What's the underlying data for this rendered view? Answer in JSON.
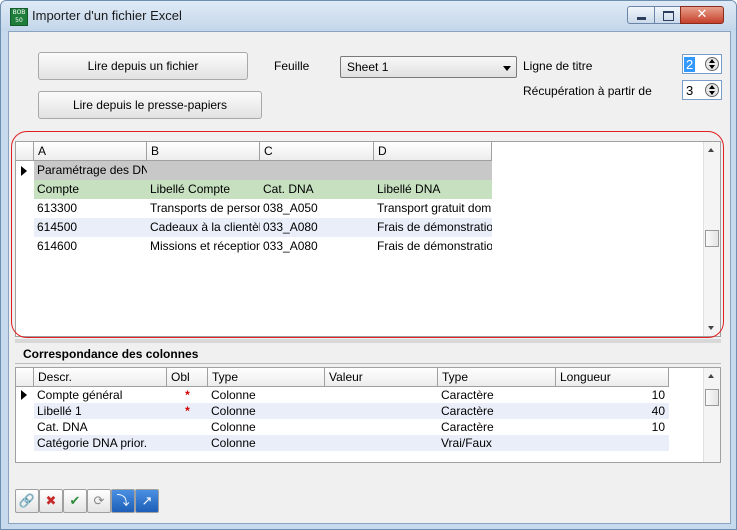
{
  "window": {
    "title": "Importer d'un fichier Excel",
    "app_icon_text": "BOB 50",
    "close_glyph": "✕"
  },
  "top": {
    "read_file_label": "Lire depuis un fichier",
    "read_clipboard_label": "Lire depuis le presse-papiers",
    "sheet_label": "Feuille",
    "sheet_value": "Sheet 1",
    "title_row_label": "Ligne de titre",
    "title_row_value": "2",
    "start_row_label": "Récupération à partir de",
    "start_row_value": "3"
  },
  "grid1": {
    "columns": [
      "A",
      "B",
      "C",
      "D"
    ],
    "rows": [
      {
        "cells": [
          "Paramétrage des DNA",
          "",
          "",
          ""
        ],
        "style": "gray",
        "current": true
      },
      {
        "cells": [
          "Compte",
          "Libellé Compte",
          "Cat. DNA",
          "Libellé DNA"
        ],
        "style": "green",
        "current": false
      },
      {
        "cells": [
          "613300",
          "Transports de personnel",
          "038_A050",
          "Transport gratuit domicile"
        ],
        "style": "white",
        "current": false
      },
      {
        "cells": [
          "614500",
          "Cadeaux à la clientèle",
          "033_A080",
          "Frais de démonstration"
        ],
        "style": "blue",
        "current": false
      },
      {
        "cells": [
          "614600",
          "Missions et réceptions",
          "033_A080",
          "Frais de démonstration"
        ],
        "style": "white",
        "current": false
      }
    ]
  },
  "mapping": {
    "section_title": "Correspondance des colonnes",
    "columns": [
      "Descr.",
      "Obl",
      "Type",
      "Valeur",
      "Type",
      "Longueur"
    ],
    "rows": [
      {
        "descr": "Compte général",
        "obl": "*",
        "type": "Colonne",
        "valeur": "",
        "type2": "Caractère",
        "longueur": "10",
        "current": true
      },
      {
        "descr": "Libellé 1",
        "obl": "*",
        "type": "Colonne",
        "valeur": "",
        "type2": "Caractère",
        "longueur": "40",
        "current": false
      },
      {
        "descr": "Cat. DNA",
        "obl": "",
        "type": "Colonne",
        "valeur": "",
        "type2": "Caractère",
        "longueur": "10",
        "current": false
      },
      {
        "descr": "Catégorie DNA prior.",
        "obl": "",
        "type": "Colonne",
        "valeur": "",
        "type2": "Vrai/Faux",
        "longueur": "",
        "current": false
      }
    ]
  },
  "toolbar": {
    "buttons": [
      {
        "icon": "link-icon",
        "glyph": "🔗"
      },
      {
        "icon": "cancel-icon",
        "glyph": "✖"
      },
      {
        "icon": "checked-folder-icon",
        "glyph": "✔"
      },
      {
        "icon": "refresh-icon",
        "glyph": "⟳"
      },
      {
        "icon": "import-icon",
        "glyph": "⤵"
      },
      {
        "icon": "export-icon",
        "glyph": "↗"
      }
    ]
  },
  "colors": {
    "row_gray": "#c8c8c8",
    "row_green": "#c6e0c0",
    "row_blue": "#e9eef8",
    "highlight": "#e02020",
    "obl_mark": "#d00000"
  }
}
